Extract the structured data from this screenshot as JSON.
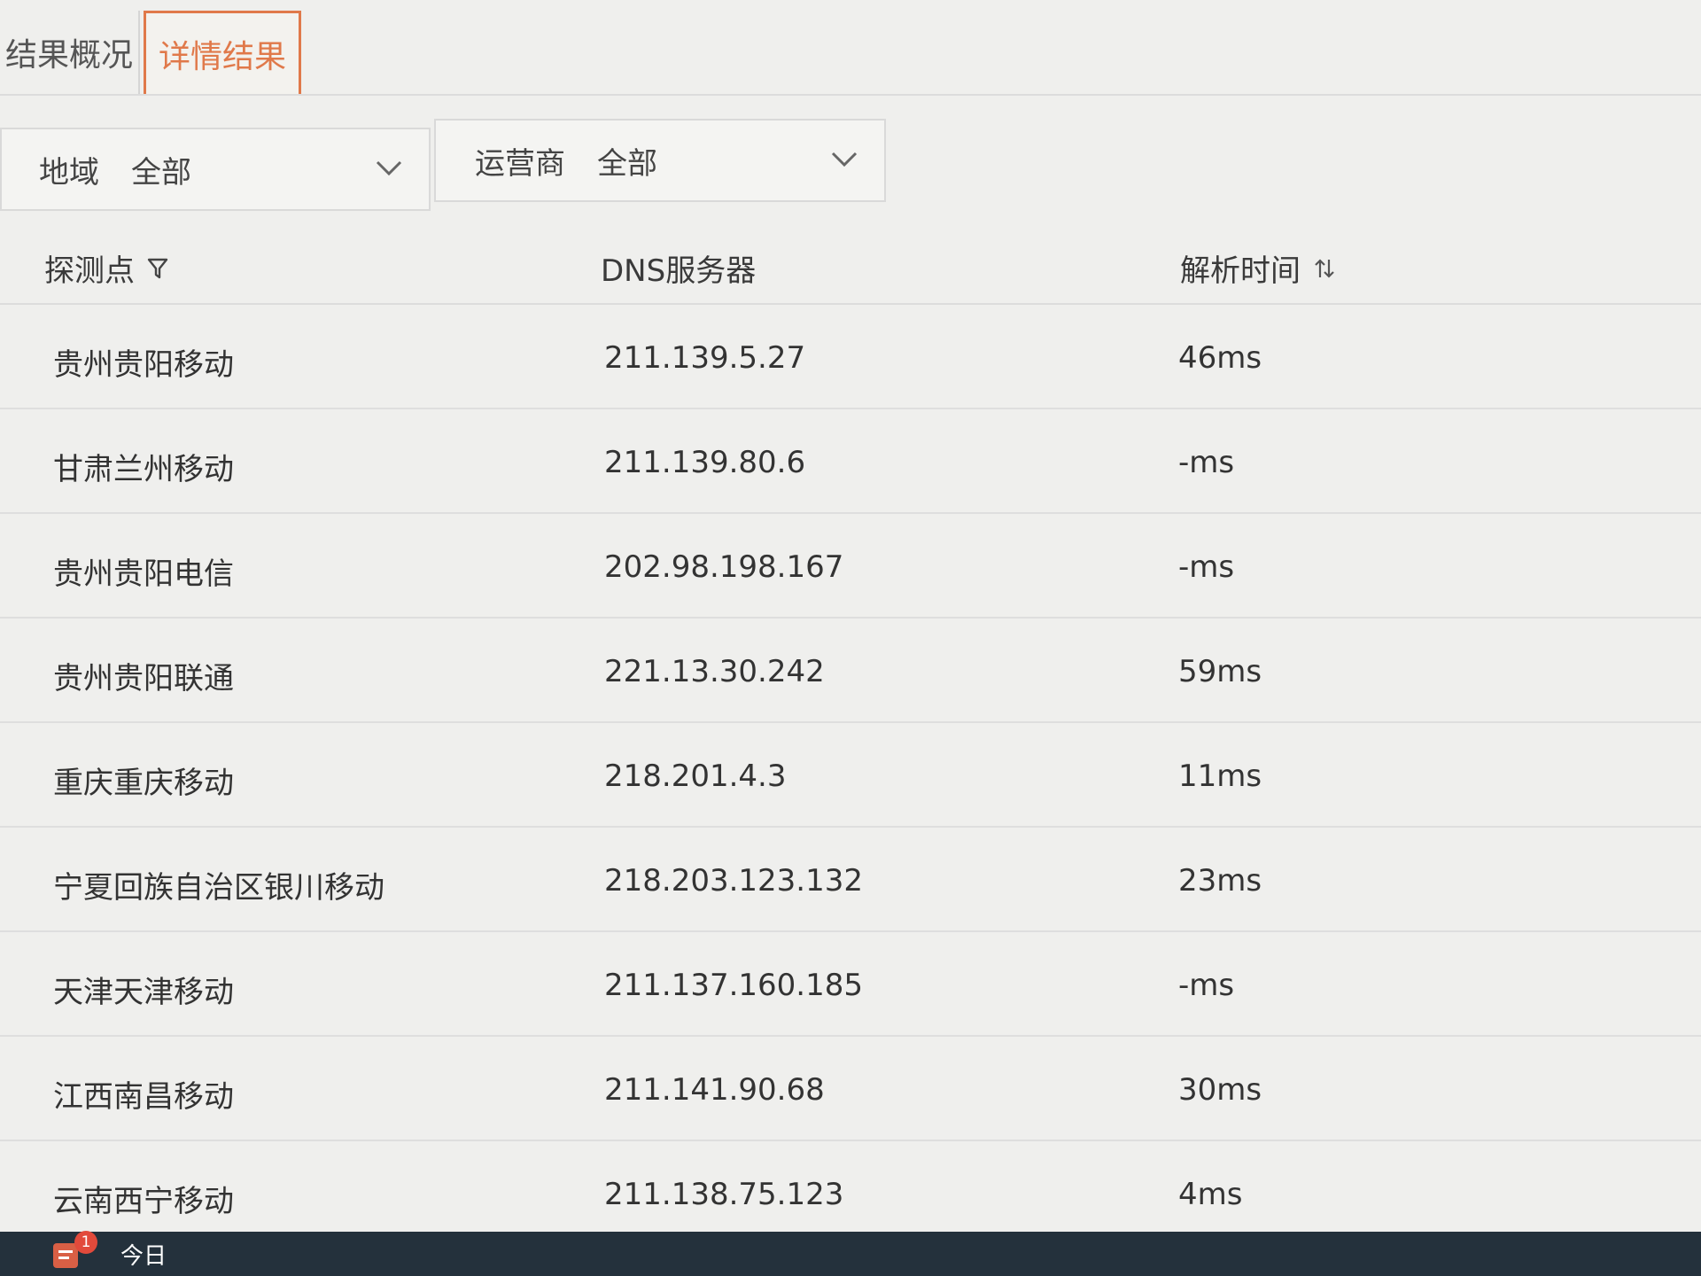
{
  "tabs": [
    {
      "label": "结果概况",
      "active": false
    },
    {
      "label": "详情结果",
      "active": true
    }
  ],
  "filters": {
    "region": {
      "label": "地域",
      "value": "全部"
    },
    "carrier": {
      "label": "运营商",
      "value": "全部"
    }
  },
  "table": {
    "headers": {
      "probe": "探测点",
      "dns": "DNS服务器",
      "time": "解析时间"
    },
    "rows": [
      {
        "probe": "贵州贵阳移动",
        "dns": "211.139.5.27",
        "time": "46ms"
      },
      {
        "probe": "甘肃兰州移动",
        "dns": "211.139.80.6",
        "time": "-ms"
      },
      {
        "probe": "贵州贵阳电信",
        "dns": "202.98.198.167",
        "time": "-ms"
      },
      {
        "probe": "贵州贵阳联通",
        "dns": "221.13.30.242",
        "time": "59ms"
      },
      {
        "probe": "重庆重庆移动",
        "dns": "218.201.4.3",
        "time": "11ms"
      },
      {
        "probe": "宁夏回族自治区银川移动",
        "dns": "218.203.123.132",
        "time": "23ms"
      },
      {
        "probe": "天津天津移动",
        "dns": "211.137.160.185",
        "time": "-ms"
      },
      {
        "probe": "江西南昌移动",
        "dns": "211.141.90.68",
        "time": "30ms"
      },
      {
        "probe": "云南西宁移动",
        "dns": "211.138.75.123",
        "time": "4ms"
      }
    ]
  },
  "taskbar": {
    "badge": "1",
    "today": "今日"
  },
  "colors": {
    "accent": "#e0794a",
    "taskbar": "#24313c",
    "badge": "#e24a3b"
  }
}
